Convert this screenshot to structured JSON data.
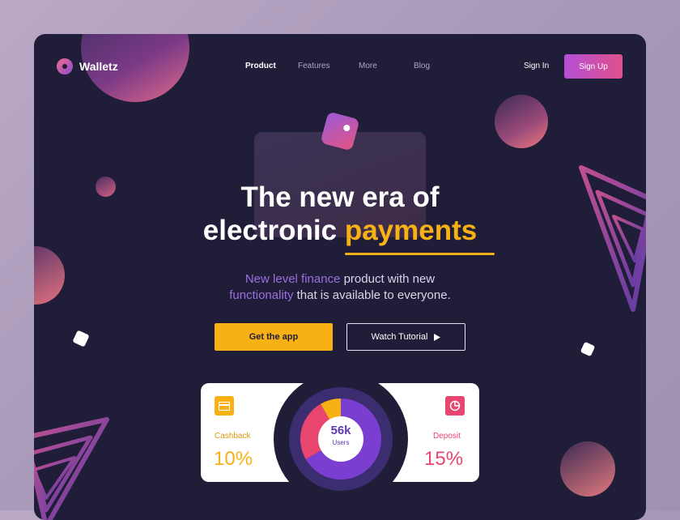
{
  "brand": {
    "name": "Walletz"
  },
  "nav": {
    "items": [
      {
        "label": "Product",
        "active": true
      },
      {
        "label": "Features",
        "active": false
      },
      {
        "label": "More",
        "active": false
      },
      {
        "label": "Blog",
        "active": false
      }
    ],
    "signin": "Sign In",
    "signup": "Sign Up"
  },
  "hero": {
    "title_line1": "The new era of",
    "title_line2_prefix": "electronic ",
    "title_line2_accent": "payments",
    "subtitle_line1_accent": "New level finance",
    "subtitle_line1_rest": " product with new",
    "subtitle_line2_accent": "functionality",
    "subtitle_line2_rest": " that is available to everyone."
  },
  "buttons": {
    "get_app": "Get the app",
    "watch": "Watch Tutorial"
  },
  "stats": {
    "cashback": {
      "label": "Cashback",
      "value": "10%"
    },
    "deposit": {
      "label": "Deposit",
      "value": "15%"
    },
    "users": {
      "value": "56k",
      "label": "Users"
    }
  },
  "colors": {
    "accent": "#f8b114",
    "brand_purple": "#8a4bd6",
    "pink": "#e8456f",
    "background": "#1f1d38"
  },
  "icons": {
    "logo": "ring-logo-icon",
    "watch": "play-icon",
    "cashback": "credit-card-icon",
    "deposit": "pie-chart-icon"
  }
}
